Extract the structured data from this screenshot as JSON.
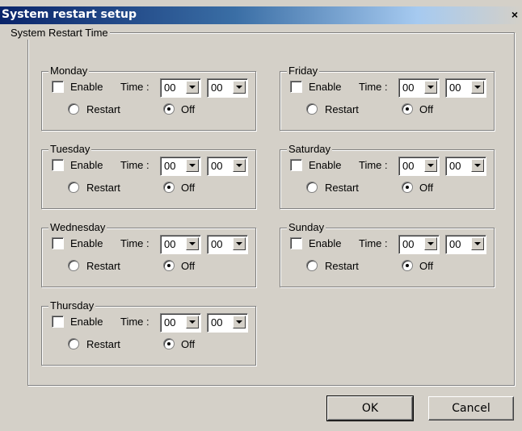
{
  "window": {
    "title": "System restart setup",
    "close_glyph": "×"
  },
  "outer_group": {
    "title": "System Restart Time"
  },
  "labels": {
    "enable": "Enable",
    "time": "Time :",
    "restart": "Restart",
    "off": "Off"
  },
  "days": [
    {
      "name": "Monday",
      "enabled": false,
      "hour": "00",
      "minute": "00",
      "mode": "Off"
    },
    {
      "name": "Tuesday",
      "enabled": false,
      "hour": "00",
      "minute": "00",
      "mode": "Off"
    },
    {
      "name": "Wednesday",
      "enabled": false,
      "hour": "00",
      "minute": "00",
      "mode": "Off"
    },
    {
      "name": "Thursday",
      "enabled": false,
      "hour": "00",
      "minute": "00",
      "mode": "Off"
    },
    {
      "name": "Friday",
      "enabled": false,
      "hour": "00",
      "minute": "00",
      "mode": "Off"
    },
    {
      "name": "Saturday",
      "enabled": false,
      "hour": "00",
      "minute": "00",
      "mode": "Off"
    },
    {
      "name": "Sunday",
      "enabled": false,
      "hour": "00",
      "minute": "00",
      "mode": "Off"
    }
  ],
  "buttons": {
    "ok": "OK",
    "cancel": "Cancel"
  }
}
